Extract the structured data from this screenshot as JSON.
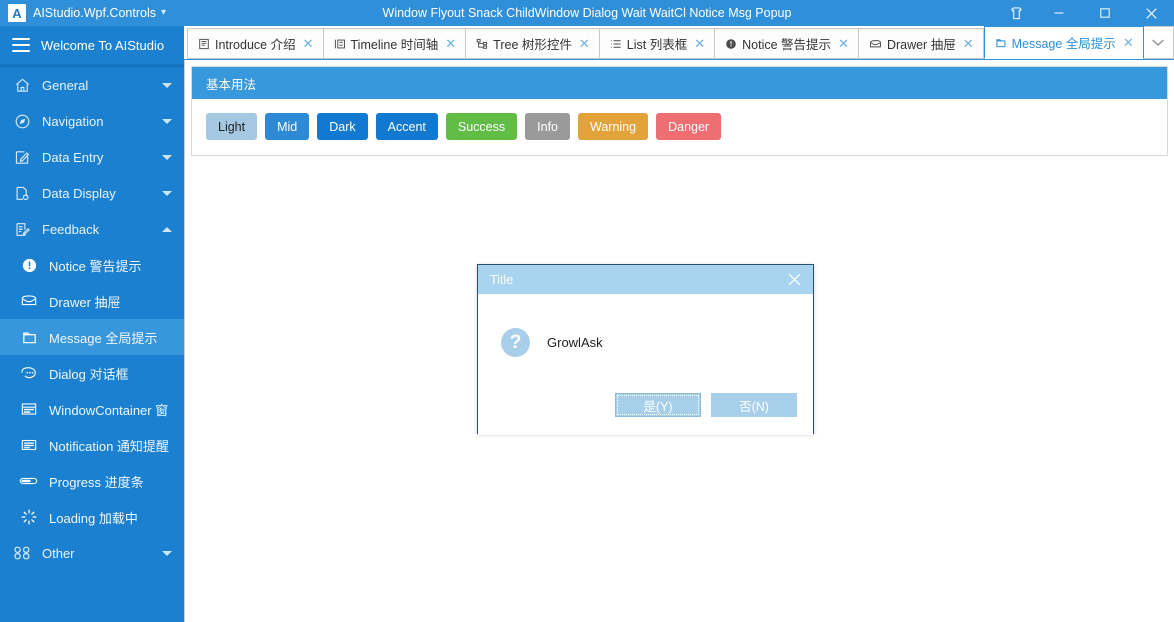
{
  "titlebar": {
    "logo_text": "A",
    "app_title": "AIStudio.Wpf.Controls",
    "caret_icon": "chevron-down-icon",
    "center_title": "Window Flyout Snack ChildWindow Dialog Wait WaitCl Notice Msg Popup",
    "skin_icon": "skin-icon",
    "minimize_icon": "minimize-icon",
    "maximize_icon": "maximize-icon",
    "close_icon": "close-icon"
  },
  "sidebar": {
    "header_label": "Welcome To AIStudio",
    "menu_icon": "hamburger-icon",
    "groups": [
      {
        "label": "General",
        "icon": "home-icon",
        "expanded": false
      },
      {
        "label": "Navigation",
        "icon": "compass-icon",
        "expanded": false
      },
      {
        "label": "Data Entry",
        "icon": "edit-box-icon",
        "expanded": false
      },
      {
        "label": "Data Display",
        "icon": "file-search-icon",
        "expanded": false
      },
      {
        "label": "Feedback",
        "icon": "clipboard-edit-icon",
        "expanded": true
      }
    ],
    "feedback_items": [
      {
        "label": "Notice 警告提示",
        "icon": "exclamation-circle-icon",
        "active": false
      },
      {
        "label": "Drawer 抽屉",
        "icon": "drawer-icon",
        "active": false
      },
      {
        "label": "Message 全局提示",
        "icon": "message-box-icon",
        "active": true
      },
      {
        "label": "Dialog 对话框",
        "icon": "chat-bubble-icon",
        "active": false
      },
      {
        "label": "WindowContainer 窗",
        "icon": "window-icon",
        "active": false
      },
      {
        "label": "Notification 通知提醒",
        "icon": "notification-icon",
        "active": false
      },
      {
        "label": "Progress 进度条",
        "icon": "progress-icon",
        "active": false
      },
      {
        "label": "Loading 加载中",
        "icon": "loading-spinner-icon",
        "active": false
      }
    ],
    "other_group": {
      "label": "Other",
      "icon": "grid-dots-icon",
      "expanded": false
    }
  },
  "tabs": {
    "items": [
      {
        "label": "Introduce 介绍",
        "icon": "book-icon",
        "active": false
      },
      {
        "label": "Timeline 时间轴",
        "icon": "timeline-icon",
        "active": false
      },
      {
        "label": "Tree 树形控件",
        "icon": "tree-icon",
        "active": false
      },
      {
        "label": "List 列表框",
        "icon": "list-icon",
        "active": false
      },
      {
        "label": "Notice 警告提示",
        "icon": "exclamation-circle-icon",
        "active": false
      },
      {
        "label": "Drawer 抽屉",
        "icon": "drawer-icon",
        "active": false
      },
      {
        "label": "Message 全局提示",
        "icon": "message-box-icon",
        "active": true
      }
    ],
    "close_glyph": "✕",
    "overflow_icon": "chevron-down-icon"
  },
  "panel": {
    "title": "基本用法",
    "buttons": [
      {
        "label": "Light",
        "bg": "#a4c8e1",
        "fg": "#222222"
      },
      {
        "label": "Mid",
        "bg": "#2e8ad4",
        "fg": "#ffffff"
      },
      {
        "label": "Dark",
        "bg": "#1179d0",
        "fg": "#ffffff"
      },
      {
        "label": "Accent",
        "bg": "#1179d0",
        "fg": "#ffffff"
      },
      {
        "label": "Success",
        "bg": "#62bd47",
        "fg": "#ffffff"
      },
      {
        "label": "Info",
        "bg": "#9a9a9a",
        "fg": "#ffffff"
      },
      {
        "label": "Warning",
        "bg": "#e2a33a",
        "fg": "#ffffff"
      },
      {
        "label": "Danger",
        "bg": "#ee6e72",
        "fg": "#ffffff"
      }
    ]
  },
  "dialog": {
    "title": "Title",
    "close_glyph": "✕",
    "icon": "question-circle-icon",
    "icon_glyph": "?",
    "message": "GrowlAsk",
    "yes_label": "是(Y)",
    "no_label": "否(N)"
  },
  "colors": {
    "brand_blue": "#2f8fd8",
    "sidebar_blue": "#1a80cf",
    "sidebar_active": "#3897dc",
    "panel_header": "#3898dc",
    "dialog_header": "#a8d4ef",
    "dialog_button": "#a8cfe9",
    "dialog_border": "#2c4f6e"
  }
}
